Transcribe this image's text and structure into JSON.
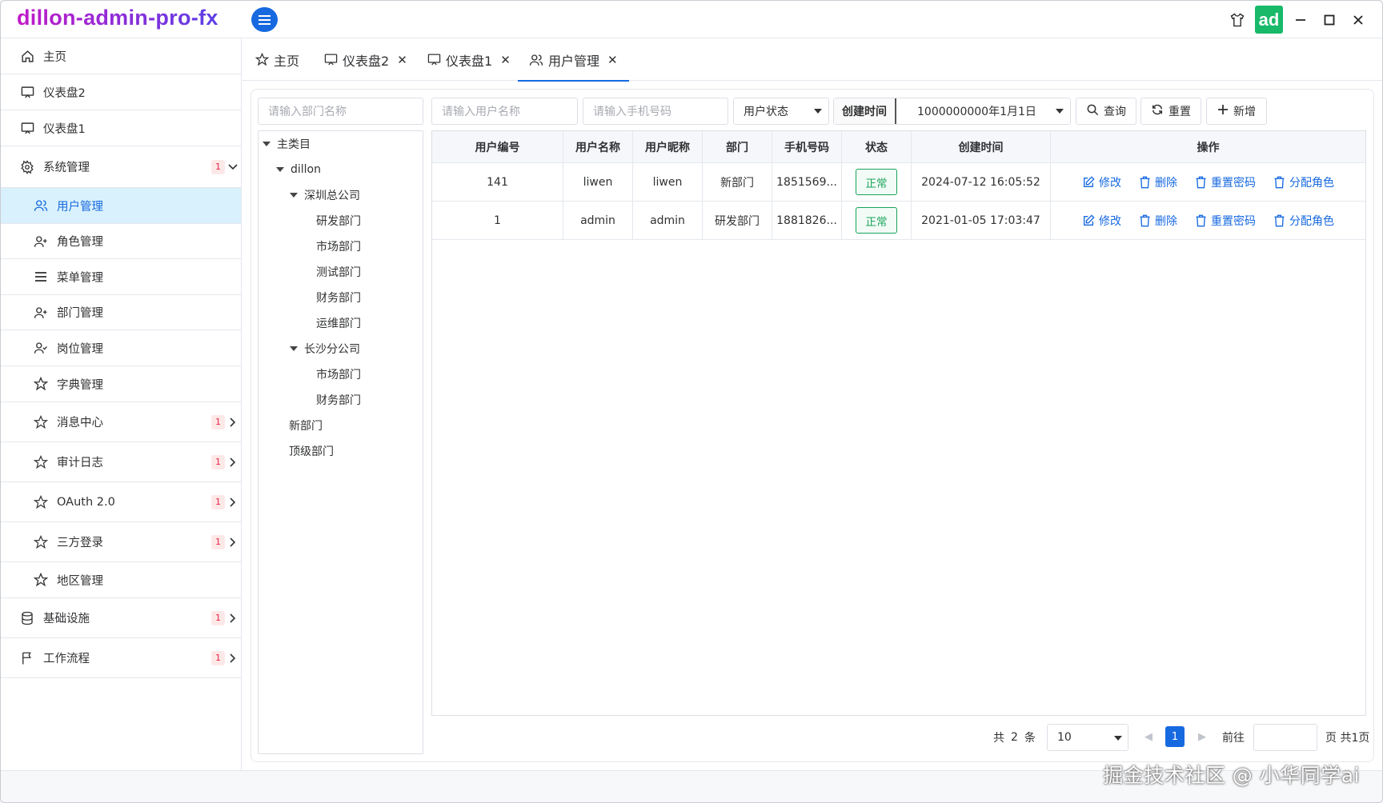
{
  "app": {
    "title": "dillon-admin-pro-fx",
    "avatar_text": "ad"
  },
  "sidebar": {
    "items": [
      {
        "label": "主页",
        "icon": "home-icon"
      },
      {
        "label": "仪表盘2",
        "icon": "monitor-icon"
      },
      {
        "label": "仪表盘1",
        "icon": "monitor-icon"
      },
      {
        "label": "系统管理",
        "icon": "gear-icon",
        "badge": "1"
      },
      {
        "label": "用户管理",
        "icon": "users-icon"
      },
      {
        "label": "角色管理",
        "icon": "user-plus-icon"
      },
      {
        "label": "菜单管理",
        "icon": "menu-icon"
      },
      {
        "label": "部门管理",
        "icon": "user-plus-icon"
      },
      {
        "label": "岗位管理",
        "icon": "user-check-icon"
      },
      {
        "label": "字典管理",
        "icon": "star-icon"
      },
      {
        "label": "消息中心",
        "icon": "star-icon",
        "badge": "1"
      },
      {
        "label": "审计日志",
        "icon": "star-icon",
        "badge": "1"
      },
      {
        "label": "OAuth 2.0",
        "icon": "star-icon",
        "badge": "1"
      },
      {
        "label": "三方登录",
        "icon": "star-icon",
        "badge": "1"
      },
      {
        "label": "地区管理",
        "icon": "star-icon"
      },
      {
        "label": "基础设施",
        "icon": "database-icon",
        "badge": "1"
      },
      {
        "label": "工作流程",
        "icon": "flag-icon",
        "badge": "1"
      }
    ]
  },
  "tabs": [
    {
      "label": "主页"
    },
    {
      "label": "仪表盘2"
    },
    {
      "label": "仪表盘1"
    },
    {
      "label": "用户管理"
    }
  ],
  "filters": {
    "dept_placeholder": "请输入部门名称",
    "username_placeholder": "请输入用户名称",
    "phone_placeholder": "请输入手机号码",
    "status_label": "用户状态",
    "created_label": "创建时间",
    "created_value": "1000000000年1月1日",
    "query_label": "查询",
    "reset_label": "重置",
    "add_label": "新增"
  },
  "tree": [
    "主类目",
    "dillon",
    "深圳总公司",
    "研发部门",
    "市场部门",
    "测试部门",
    "财务部门",
    "运维部门",
    "长沙分公司",
    "市场部门",
    "财务部门",
    "新部门",
    "顶级部门"
  ],
  "table": {
    "headers": [
      "用户编号",
      "用户名称",
      "用户昵称",
      "部门",
      "手机号码",
      "状态",
      "创建时间",
      "操作"
    ],
    "rows": [
      {
        "id": "141",
        "username": "liwen",
        "nickname": "liwen",
        "dept": "新部门",
        "phone": "1851569...",
        "status": "正常",
        "created": "2024-07-12 16:05:52"
      },
      {
        "id": "1",
        "username": "admin",
        "nickname": "admin",
        "dept": "研发部门",
        "phone": "1881826...",
        "status": "正常",
        "created": "2021-01-05 17:03:47"
      }
    ],
    "ops": {
      "edit": "修改",
      "delete": "删除",
      "reset_pwd": "重置密码",
      "assign_role": "分配角色"
    }
  },
  "pagination": {
    "total_prefix": "共",
    "total": "2",
    "total_suffix": "条",
    "page_size": "10",
    "current_page": "1",
    "goto_label": "前往",
    "page_suffix": "页 共1页"
  },
  "watermark": "掘金技术社区 @ 小华同学ai"
}
